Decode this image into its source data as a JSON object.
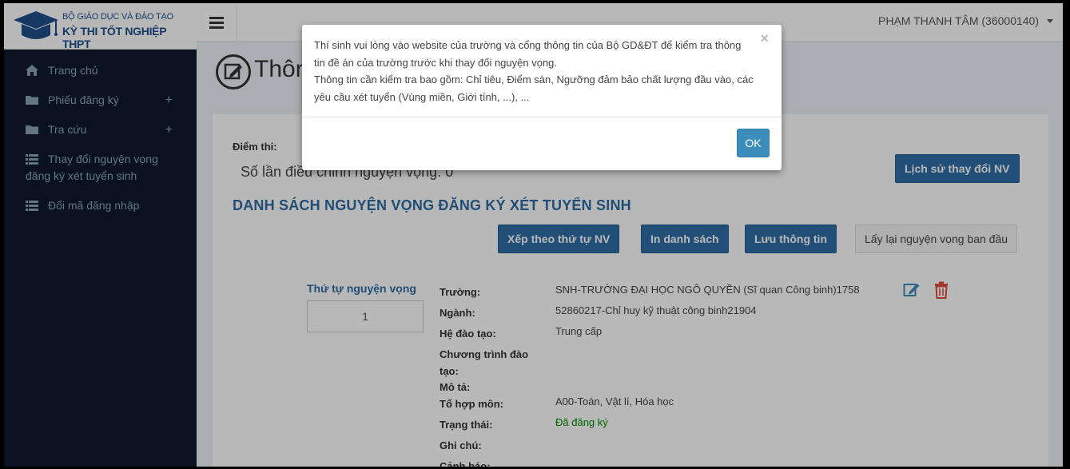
{
  "header": {
    "logo_line1": "BỘ GIÁO DỤC VÀ ĐÀO TẠO",
    "logo_line2": "KỲ THI TỐT NGHIỆP THPT",
    "user": "PHẠM THANH TÂM (36000140)"
  },
  "sidebar": {
    "items": [
      {
        "label": "Trang chủ",
        "icon": "home-icon"
      },
      {
        "label": "Phiếu đăng ký",
        "icon": "folder-icon",
        "expand": "+"
      },
      {
        "label": "Tra cứu",
        "icon": "folder-icon",
        "expand": "+"
      },
      {
        "label": "Thay đổi nguyện vọng",
        "label2": "đăng ký xét tuyển sinh",
        "icon": "list-icon"
      },
      {
        "label": "Đổi mã đăng nhập",
        "icon": "list-icon"
      }
    ]
  },
  "page": {
    "title": "Thôn"
  },
  "main": {
    "score_label": "Điểm thi:",
    "adjust_count": "Số lần điều chỉnh nguyện vọng: 0",
    "history_button": "Lịch sử thay đổi NV",
    "section_title": "DANH SÁCH NGUYỆN VỌNG ĐĂNG KÝ XÉT TUYỂN SINH",
    "buttons": {
      "sort": "Xếp theo thứ tự NV",
      "print": "In danh sách",
      "save": "Lưu thông tin",
      "reset": "Lấy lại nguyện vọng ban đầu"
    },
    "order_label": "Thứ tự nguyện vọng",
    "order_value": "1",
    "details": {
      "school_k": "Trường:",
      "school_v": "SNH-TRƯỜNG ĐẠI HỌC NGÔ QUYỀN (Sĩ quan Công binh)1758",
      "major_k": "Ngành:",
      "major_v": "52860217-Chỉ huy kỹ thuật công binh21904",
      "level_k": "Hệ đào tạo:",
      "level_v": "Trung cấp",
      "program_k1": "Chương trình đào",
      "program_k2": "tạo:",
      "desc_k": "Mô tả:",
      "combo_k": "Tổ hợp môn:",
      "combo_v": "A00-Toán, Vật lí, Hóa học",
      "status_k": "Trạng thái:",
      "status_v": "Đã đăng ký",
      "note_k": "Ghi chú:",
      "warn_k": "Cảnh báo:"
    }
  },
  "modal": {
    "line1": "Thí sinh vui lòng vào website của trường và cổng thông tin của Bộ GD&ĐT để kiểm tra thông",
    "line2": "tin đề án của trường trước khi thay đổi nguyện vọng.",
    "line3": "Thông tin cần kiểm tra bao gồm: Chỉ tiêu, Điểm sàn, Ngưỡng đảm bảo chất lượng đầu vào, các",
    "line4": "yêu cầu xét tuyển (Vùng miền, Giới tính, ...), ...",
    "close": "×",
    "ok": "OK"
  },
  "colors": {
    "sidebar_bg": "#0e1a2d",
    "primary": "#3c8dbc",
    "section_title": "#2e6da4",
    "status_green": "#008d00",
    "delete_red": "#dd4b39"
  }
}
